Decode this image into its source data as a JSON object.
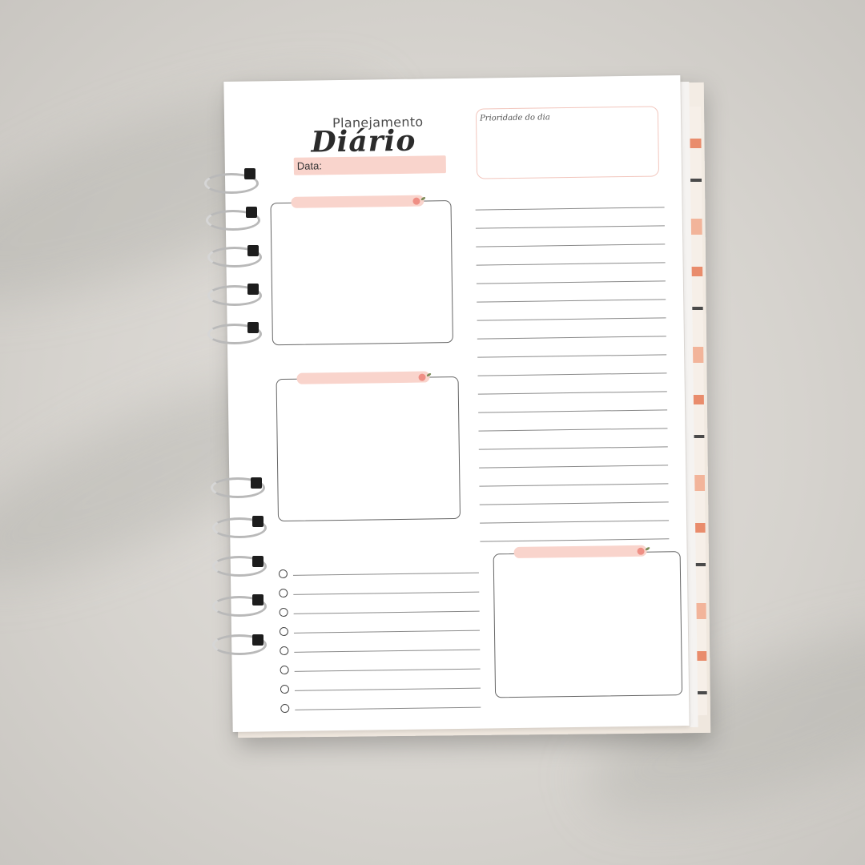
{
  "planner": {
    "title_small": "Planejamento",
    "title_big": "Diário",
    "date_label": "Data:",
    "priority_label": "Prioridade do dia"
  },
  "colors": {
    "accent_pink": "#f9d4cc",
    "border_pink": "#f2c6bd",
    "ink": "#2b2b2b"
  },
  "icons": [
    "flower-icon",
    "spiral-binding"
  ]
}
